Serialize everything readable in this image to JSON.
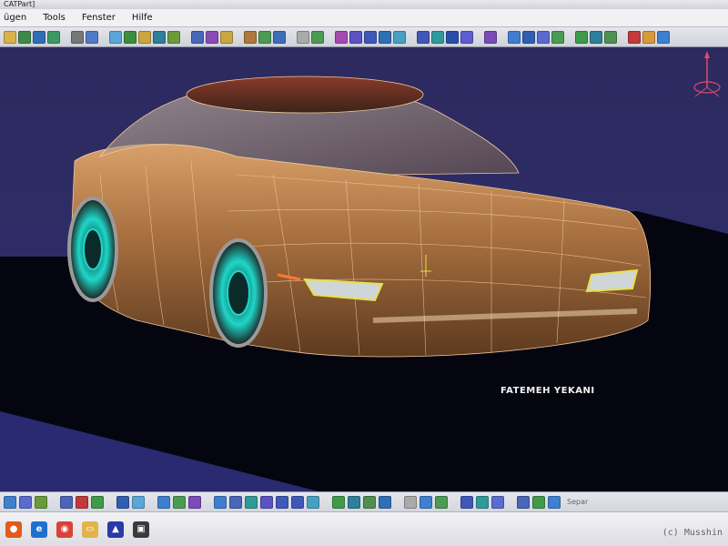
{
  "window": {
    "title": "CATPart]"
  },
  "menu": {
    "items": [
      {
        "label": "ügen"
      },
      {
        "label": "Tools"
      },
      {
        "label": "Fenster"
      },
      {
        "label": "Hilfe"
      }
    ]
  },
  "viewport": {
    "caption": "FATEMEH YEKANI",
    "background_color": "#2e2c66",
    "floor_color": "#050510",
    "model_color": "#b07a45",
    "wireframe_color": "#f1c99c",
    "wheel_accent_color": "#1fd6c8"
  },
  "bottom_toolbar": {
    "status_text": "Separ"
  },
  "taskbar": {
    "icons": [
      "firefox-icon",
      "edge-icon",
      "chrome-icon",
      "folder-icon",
      "catia-icon",
      "app-window-icon"
    ]
  },
  "watermark": {
    "text": "(c) Musshin"
  }
}
